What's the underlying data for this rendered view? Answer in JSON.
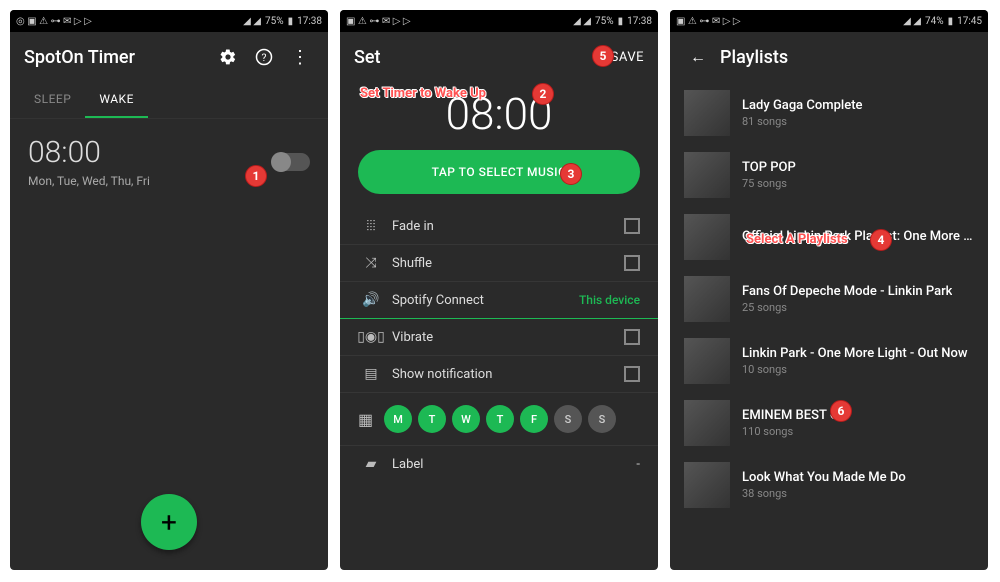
{
  "statusbar": {
    "battery1": "75%",
    "time1": "17:38",
    "battery2": "75%",
    "time2": "17:38",
    "battery3": "74%",
    "time3": "17:45"
  },
  "phone1": {
    "title": "SpotOn Timer",
    "tabs": {
      "sleep": "SLEEP",
      "wake": "WAKE"
    },
    "alarm": {
      "time": "08:00",
      "days": "Mon, Tue, Wed, Thu, Fri"
    },
    "fab": "+"
  },
  "phone2": {
    "title": "Set",
    "save": "SAVE",
    "annotation": "Set Timer to Wake Up",
    "time": "08:00",
    "selectMusic": "TAP TO SELECT MUSIC",
    "opts": {
      "fadein": "Fade in",
      "shuffle": "Shuffle",
      "spotify": "Spotify Connect",
      "spotifyVal": "This device",
      "vibrate": "Vibrate",
      "notif": "Show notification",
      "label": "Label",
      "labelVal": "-"
    },
    "days": [
      "M",
      "T",
      "W",
      "T",
      "F",
      "S",
      "S"
    ]
  },
  "phone3": {
    "title": "Playlists",
    "annotation": "Select A Playlists",
    "items": [
      {
        "title": "Lady Gaga Complete",
        "sub": "81 songs"
      },
      {
        "title": "TOP POP",
        "sub": "75 songs"
      },
      {
        "title": "Official Linkin Park Playlist: One More Light",
        "sub": ""
      },
      {
        "title": "Fans Of Depeche Mode - Linkin Park",
        "sub": "25 songs"
      },
      {
        "title": "Linkin Park - One More Light - Out Now",
        "sub": "10 songs"
      },
      {
        "title": "EMINEM BEST OF",
        "sub": "110 songs"
      },
      {
        "title": "Look What You Made Me Do",
        "sub": "38 songs"
      }
    ]
  },
  "badges": {
    "1": "1",
    "2": "2",
    "3": "3",
    "4": "4",
    "5": "5",
    "6": "6"
  }
}
